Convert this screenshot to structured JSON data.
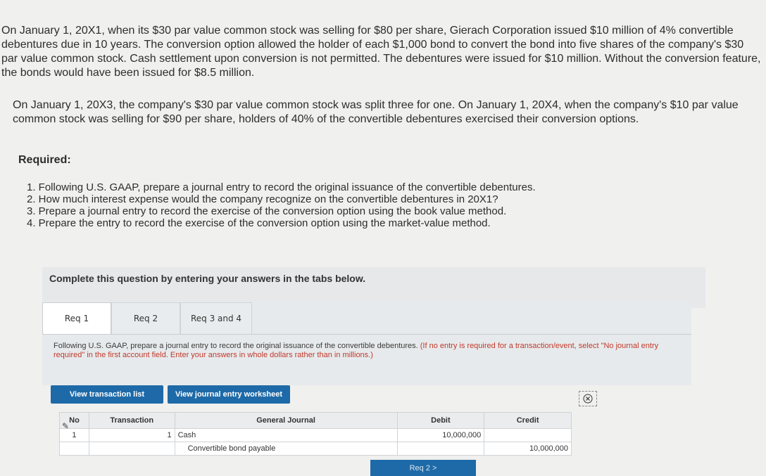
{
  "problem": {
    "paragraph1": "On January 1, 20X1, when its $30 par value common stock was selling for $80 per share, Gierach Corporation issued $10 million of 4% convertible debentures due in 10 years. The conversion option allowed the holder of each $1,000 bond to convert the bond into five shares of the company's $30 par value common stock. Cash settlement upon conversion is not permitted. The debentures were issued for $10 million. Without the conversion feature, the bonds would have been issued for $8.5 million.",
    "paragraph2": "On January 1, 20X3, the company's $30 par value common stock was split three for one. On January 1, 20X4, when the company's $10 par value common stock was selling for $90 per share, holders of 40% of the convertible debentures exercised their conversion options.",
    "required_label": "Required:",
    "requirements": [
      "1. Following U.S. GAAP, prepare a journal entry to record the original issuance of the convertible debentures.",
      "2. How much interest expense would the company recognize on the convertible debentures in 20X1?",
      "3. Prepare a journal entry to record the exercise of the conversion option using the book value method.",
      "4. Prepare the entry to record the exercise of the conversion option using the market-value method."
    ]
  },
  "instructions": "Complete this question by entering your answers in the tabs below.",
  "tabs": [
    {
      "label": "Req 1"
    },
    {
      "label": "Req 2"
    },
    {
      "label": "Req 3 and 4"
    }
  ],
  "req1": {
    "instruction": "Following U.S. GAAP, prepare a journal entry to record the original issuance of the convertible debentures.",
    "note": "(If no entry is required for a transaction/event, select \"No journal entry required\" in the first account field. Enter your answers in whole dollars rather than in millions.)"
  },
  "buttons": {
    "view_transactions": "View transaction list",
    "view_worksheet": "View journal entry worksheet",
    "next": "Req 2  >"
  },
  "journal": {
    "headers": {
      "no": "No",
      "transaction": "Transaction",
      "general_journal": "General Journal",
      "debit": "Debit",
      "credit": "Credit"
    },
    "rows": [
      {
        "no": "1",
        "transaction": "1",
        "account": "Cash",
        "debit": "10,000,000",
        "credit": ""
      },
      {
        "no": "",
        "transaction": "",
        "account": "Convertible bond payable",
        "debit": "",
        "credit": "10,000,000"
      }
    ]
  },
  "icons": {
    "edit": "pencil-icon",
    "close": "close-icon"
  }
}
